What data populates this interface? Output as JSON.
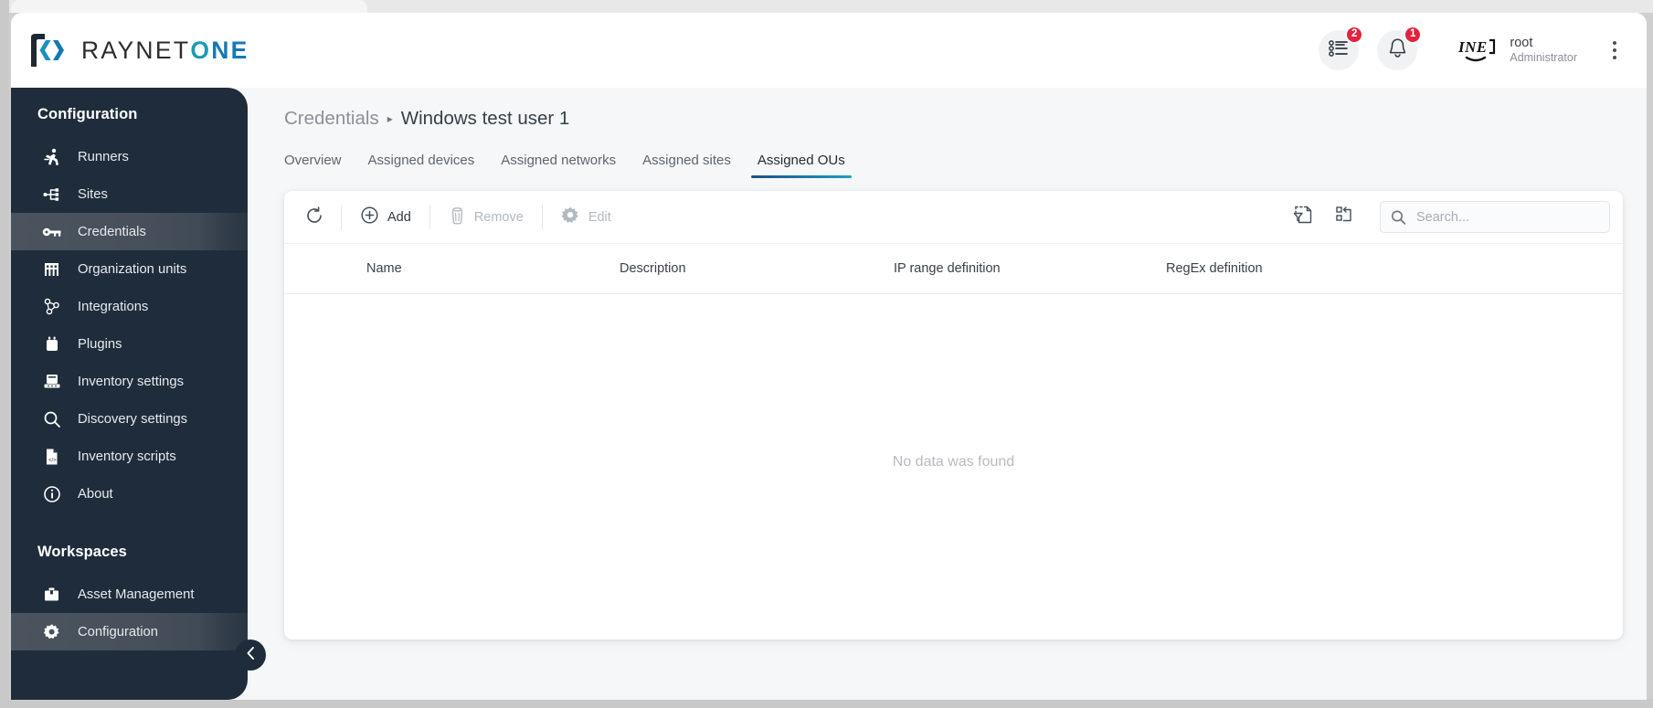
{
  "brand": {
    "logo_icon": "raynet-bracket-logo",
    "name_part1": "RAYNET",
    "name_o": "O",
    "name_ne": "NE"
  },
  "topbar": {
    "tasks": {
      "icon": "list-icon",
      "badge": "2"
    },
    "notifications": {
      "icon": "bell-icon",
      "badge": "1"
    },
    "user": {
      "avatar_icon": "inet-logo",
      "name": "root",
      "role": "Administrator"
    },
    "overflow": {
      "icon": "kebab-menu-icon"
    }
  },
  "sidebar": {
    "configuration_title": "Configuration",
    "workspaces_title": "Workspaces",
    "items": [
      {
        "label": "Runners",
        "icon": "runner-icon",
        "active": false
      },
      {
        "label": "Sites",
        "icon": "sitemap-icon",
        "active": false
      },
      {
        "label": "Credentials",
        "icon": "key-icon",
        "active": true
      },
      {
        "label": "Organization units",
        "icon": "building-icon",
        "active": false
      },
      {
        "label": "Integrations",
        "icon": "integrations-icon",
        "active": false
      },
      {
        "label": "Plugins",
        "icon": "plugin-icon",
        "active": false
      },
      {
        "label": "Inventory settings",
        "icon": "inventory-settings-icon",
        "active": false
      },
      {
        "label": "Discovery settings",
        "icon": "magnifier-icon",
        "active": false
      },
      {
        "label": "Inventory scripts",
        "icon": "script-file-icon",
        "active": false
      },
      {
        "label": "About",
        "icon": "info-circle-icon",
        "active": false
      }
    ],
    "workspaces": [
      {
        "label": "Asset Management",
        "icon": "briefcase-icon",
        "active": false
      },
      {
        "label": "Configuration",
        "icon": "gear-icon",
        "active": true
      }
    ],
    "collapse_icon": "chevron-left-icon"
  },
  "breadcrumb": {
    "parent": "Credentials",
    "separator": "▸",
    "current": "Windows test user 1"
  },
  "tabs": [
    {
      "label": "Overview",
      "active": false
    },
    {
      "label": "Assigned devices",
      "active": false
    },
    {
      "label": "Assigned networks",
      "active": false
    },
    {
      "label": "Assigned sites",
      "active": false
    },
    {
      "label": "Assigned OUs",
      "active": true
    }
  ],
  "toolbar": {
    "refresh_label": "",
    "refresh_icon": "refresh-icon",
    "add_label": "Add",
    "add_icon": "plus-circle-icon",
    "remove_label": "Remove",
    "remove_icon": "trash-icon",
    "edit_label": "Edit",
    "edit_icon": "gear-icon",
    "export_icon": "filter-export-icon",
    "columns_icon": "reset-layout-icon"
  },
  "search": {
    "placeholder": "Search...",
    "value": "",
    "icon": "search-icon"
  },
  "table": {
    "columns": [
      "Name",
      "Description",
      "IP range definition",
      "RegEx definition"
    ],
    "rows": [],
    "empty_message": "No data was found"
  },
  "colors": {
    "sidebar_bg": "#1f2c3b",
    "badge_red": "#e0233e",
    "accent_blue": "#1f9dc4",
    "accent_dark_blue": "#1d4f80"
  }
}
